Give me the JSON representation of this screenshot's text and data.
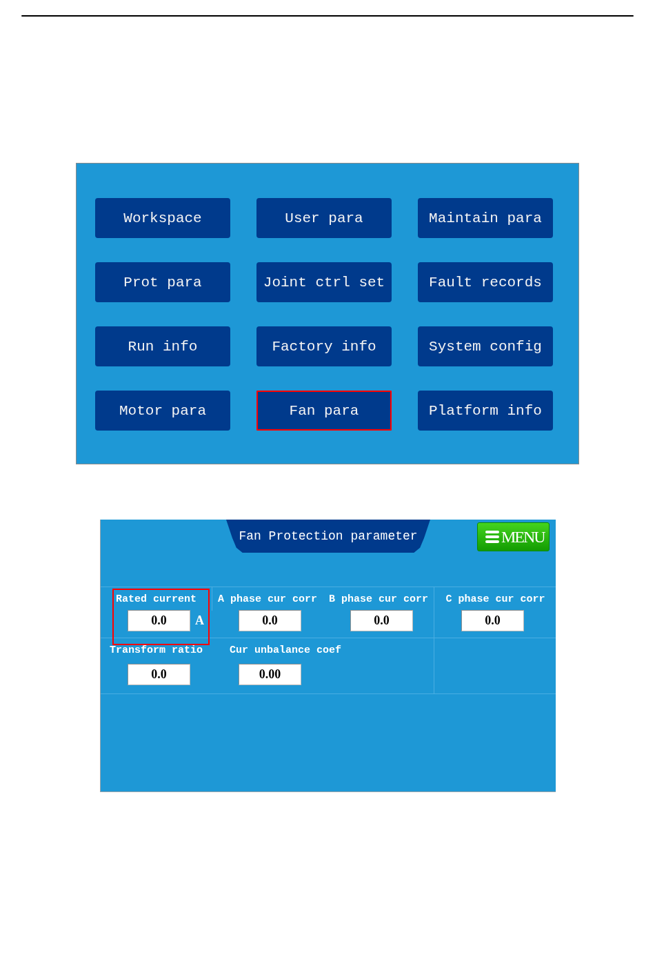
{
  "main_menu": {
    "buttons": [
      {
        "label": "Workspace",
        "selected": false
      },
      {
        "label": "User para",
        "selected": false
      },
      {
        "label": "Maintain para",
        "selected": false
      },
      {
        "label": "Prot para",
        "selected": false
      },
      {
        "label": "Joint ctrl set",
        "selected": false
      },
      {
        "label": "Fault records",
        "selected": false
      },
      {
        "label": "Run info",
        "selected": false
      },
      {
        "label": "Factory info",
        "selected": false
      },
      {
        "label": "System config",
        "selected": false
      },
      {
        "label": "Motor para",
        "selected": false
      },
      {
        "label": "Fan para",
        "selected": true
      },
      {
        "label": "Platform info",
        "selected": false
      }
    ]
  },
  "fan_protection_screen": {
    "title": "Fan Protection parameter",
    "menu_button": {
      "label": "MENU"
    },
    "rows": [
      {
        "fields": [
          {
            "label": "Rated current",
            "value": "0.0",
            "unit": "A",
            "selected": true
          },
          {
            "label": "A phase cur corr",
            "value": "0.0",
            "selected": false
          },
          {
            "label": "B phase cur corr",
            "value": "0.0",
            "selected": false
          },
          {
            "label": "C phase cur corr",
            "value": "0.0",
            "selected": false
          }
        ]
      },
      {
        "fields": [
          {
            "label": "Transform ratio",
            "value": "0.0",
            "selected": false
          },
          {
            "label": "Cur unbalance coef",
            "value": "0.00",
            "selected": false
          }
        ]
      }
    ]
  }
}
